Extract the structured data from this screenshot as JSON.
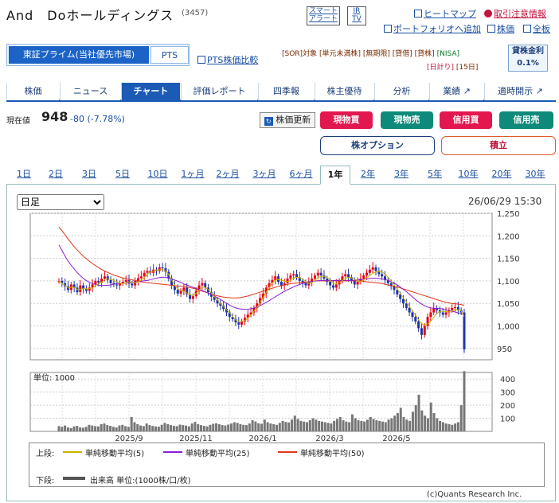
{
  "header": {
    "title": "And　Doホールディングス",
    "code": "(3457)",
    "smart_alert": [
      "スマート",
      "アラート"
    ],
    "ir_tv": [
      "IR",
      "TV"
    ],
    "links": {
      "heatmap": "ヒートマップ",
      "caution": "取引注意情報",
      "portfolio": "ポートフォリオへ追加",
      "stock": "株価",
      "board": "全板"
    }
  },
  "market": {
    "selected": "東証プライム(当社優先市場)",
    "pts": "PTS",
    "pts_compare": "PTS株価比較"
  },
  "tags": [
    "[SOR]対象",
    "[単元未満株]",
    "[無期限]",
    "[貸借]",
    "[貸株]",
    "[NISA]",
    "[日計り]",
    "[15日]"
  ],
  "lending": {
    "label": "貸株金利",
    "value": "0.1%"
  },
  "nav": {
    "tabs": [
      "株価",
      "ニュース",
      "チャート",
      "評価レポート",
      "四季報",
      "株主優待",
      "分析",
      "業績",
      "適時開示"
    ],
    "active": "チャート"
  },
  "quote": {
    "label": "現在値",
    "price": "948",
    "change": "-80 (-7.78%)",
    "update_btn": "株価更新",
    "buy_cash": "現物買",
    "sell_cash": "現物売",
    "buy_margin": "信用買",
    "sell_margin": "信用売",
    "stock_option": "株オプション",
    "accumulate": "積立"
  },
  "periods": [
    "1日",
    "2日",
    "3日",
    "5日",
    "10日",
    "1ヶ月",
    "2ヶ月",
    "3ヶ月",
    "6ヶ月",
    "1年",
    "2年",
    "3年",
    "5年",
    "10年",
    "20年",
    "30年"
  ],
  "active_period": "1年",
  "chart_controls": {
    "interval": "日足",
    "timestamp": "26/06/29 15:30"
  },
  "legend": {
    "upper_label": "上段:",
    "ma5": "単純移動平均(5)",
    "ma25": "単純移動平均(25)",
    "ma50": "単純移動平均(50)",
    "lower_label": "下段:",
    "volume": "出来高 単位:(1000株/口/枚)"
  },
  "copyright": "(c)Quants Research Inc.",
  "chart_data": [
    {
      "type": "candlestick",
      "ylim": [
        925,
        1250
      ],
      "yticks": [
        "1,250",
        "1,200",
        "1,150",
        "1,100",
        "1,050",
        "1,000",
        "950"
      ],
      "xticks": [
        "2025/9",
        "2025/11",
        "2026/1",
        "2026/3",
        "2026/5"
      ],
      "colors": {
        "up": "#e60012",
        "down": "#1f35a8",
        "ma5": "#c9b400",
        "ma25": "#8a1ed6",
        "ma50": "#e0341a"
      },
      "close_series": [
        1100,
        1095,
        1088,
        1080,
        1092,
        1085,
        1075,
        1090,
        1082,
        1078,
        1085,
        1092,
        1100,
        1096,
        1105,
        1110,
        1102,
        1095,
        1092,
        1090,
        1095,
        1098,
        1102,
        1094,
        1090,
        1100,
        1106,
        1110,
        1118,
        1122,
        1118,
        1125,
        1122,
        1130,
        1128,
        1120,
        1105,
        1090,
        1080,
        1072,
        1078,
        1085,
        1070,
        1060,
        1066,
        1078,
        1090,
        1095,
        1085,
        1075,
        1065,
        1058,
        1050,
        1045,
        1038,
        1030,
        1020,
        1015,
        1008,
        1003,
        1010,
        1018,
        1025,
        1030,
        1040,
        1050,
        1062,
        1072,
        1085,
        1095,
        1102,
        1110,
        1098,
        1090,
        1095,
        1105,
        1112,
        1115,
        1108,
        1100,
        1095,
        1090,
        1098,
        1105,
        1112,
        1118,
        1112,
        1105,
        1098,
        1090,
        1085,
        1092,
        1100,
        1110,
        1115,
        1108,
        1100,
        1092,
        1098,
        1105,
        1112,
        1118,
        1125,
        1130,
        1122,
        1115,
        1110,
        1102,
        1095,
        1088,
        1080,
        1070,
        1060,
        1050,
        1040,
        1030,
        1020,
        1010,
        995,
        980,
        1000,
        1020,
        1030,
        1040,
        1035,
        1030,
        1025,
        1030,
        1035,
        1040,
        1042,
        1035,
        1030,
        948
      ],
      "ma5": [
        1100,
        1094,
        1090,
        1084,
        1086,
        1085,
        1080,
        1082,
        1083,
        1082,
        1083,
        1086,
        1092,
        1095,
        1100,
        1105,
        1104,
        1102,
        1099,
        1095,
        1094,
        1095,
        1098,
        1097,
        1096,
        1098,
        1102,
        1108,
        1115,
        1120,
        1122,
        1124,
        1125,
        1125,
        1121,
        1110,
        1097,
        1086,
        1080,
        1078,
        1075,
        1070,
        1068,
        1070,
        1077,
        1085,
        1086,
        1082,
        1074,
        1066,
        1058,
        1050,
        1043,
        1036,
        1028,
        1020,
        1012,
        1010,
        1010,
        1013,
        1020,
        1027,
        1036,
        1046,
        1058,
        1069,
        1081,
        1092,
        1100,
        1103,
        1102,
        1100,
        1098,
        1100,
        1106,
        1108,
        1107,
        1104,
        1098,
        1094,
        1096,
        1102,
        1108,
        1110,
        1110,
        1106,
        1099,
        1093,
        1094,
        1098,
        1104,
        1107,
        1108,
        1105,
        1102,
        1098,
        1101,
        1106,
        1111,
        1116,
        1120,
        1121,
        1120,
        1115,
        1108,
        1099,
        1090,
        1080,
        1070,
        1060,
        1050,
        1040,
        1030,
        1020,
        1009,
        1003,
        1003,
        1007,
        1015,
        1025,
        1031,
        1033,
        1032,
        1031,
        1033,
        1036,
        1036,
        1034,
        1020
      ],
      "ma25": [
        1180,
        1165,
        1150,
        1138,
        1128,
        1118,
        1110,
        1103,
        1098,
        1094,
        1092,
        1090,
        1090,
        1090,
        1091,
        1093,
        1094,
        1095,
        1095,
        1096,
        1097,
        1098,
        1099,
        1100,
        1101,
        1103,
        1105,
        1107,
        1108,
        1108,
        1106,
        1103,
        1100,
        1097,
        1093,
        1090,
        1087,
        1084,
        1081,
        1078,
        1075,
        1071,
        1067,
        1063,
        1058,
        1053,
        1048,
        1043,
        1040,
        1038,
        1037,
        1037,
        1038,
        1040,
        1043,
        1047,
        1051,
        1056,
        1061,
        1066,
        1071,
        1076,
        1080,
        1084,
        1088,
        1091,
        1094,
        1096,
        1098,
        1099,
        1100,
        1101,
        1101,
        1101,
        1101,
        1101,
        1101,
        1101,
        1101,
        1101,
        1101,
        1102,
        1103,
        1104,
        1105,
        1106,
        1106,
        1105,
        1104,
        1102,
        1099,
        1095,
        1090,
        1084,
        1078,
        1071,
        1064,
        1057,
        1051,
        1046,
        1042,
        1040,
        1039,
        1039,
        1038,
        1036,
        1034,
        1032,
        1030,
        1028,
        1026
      ],
      "ma50": [
        1220,
        1208,
        1195,
        1183,
        1172,
        1162,
        1153,
        1145,
        1138,
        1132,
        1126,
        1121,
        1117,
        1113,
        1110,
        1107,
        1105,
        1103,
        1101,
        1099,
        1097,
        1096,
        1095,
        1094,
        1093,
        1092,
        1091,
        1090,
        1089,
        1088,
        1087,
        1085,
        1083,
        1080,
        1077,
        1074,
        1071,
        1068,
        1066,
        1064,
        1063,
        1062,
        1062,
        1063,
        1065,
        1067,
        1070,
        1073,
        1076,
        1079,
        1082,
        1085,
        1088,
        1090,
        1092,
        1094,
        1095,
        1096,
        1097,
        1098,
        1099,
        1100,
        1100,
        1100,
        1100,
        1100,
        1100,
        1100,
        1100,
        1100,
        1100,
        1100,
        1099,
        1098,
        1097,
        1096,
        1095,
        1093,
        1091,
        1089,
        1087,
        1084,
        1081,
        1078,
        1075,
        1072,
        1069,
        1066,
        1063,
        1060,
        1057,
        1054,
        1052,
        1050,
        1049,
        1048,
        1046
      ]
    },
    {
      "type": "bar",
      "name": "出来高",
      "ylim": [
        0,
        450
      ],
      "yticks": [
        "400",
        "300",
        "200",
        "100"
      ],
      "unit_label": "単位: 1000",
      "values": [
        40,
        35,
        45,
        30,
        25,
        38,
        42,
        30,
        28,
        35,
        50,
        45,
        40,
        38,
        55,
        60,
        48,
        42,
        35,
        30,
        45,
        50,
        40,
        35,
        110,
        70,
        55,
        45,
        40,
        60,
        48,
        42,
        38,
        36,
        50,
        65,
        55,
        48,
        42,
        40,
        52,
        48,
        44,
        38,
        60,
        72,
        55,
        48,
        42,
        38,
        50,
        58,
        62,
        55,
        48,
        45,
        52,
        60,
        70,
        65,
        55,
        50,
        48,
        60,
        85,
        75,
        62,
        58,
        90,
        70,
        60,
        55,
        50,
        65,
        80,
        72,
        68,
        90,
        120,
        95,
        80,
        75,
        70,
        85,
        100,
        90,
        80,
        75,
        70,
        65,
        60,
        80,
        95,
        110,
        85,
        75,
        70,
        130,
        100,
        85,
        80,
        75,
        90,
        110,
        95,
        85,
        80,
        75,
        70,
        90,
        100,
        120,
        140,
        180,
        110,
        90,
        80,
        150,
        200,
        280,
        160,
        120,
        100,
        220,
        140,
        100,
        80,
        70,
        60,
        55,
        50,
        60,
        70,
        200,
        460
      ]
    }
  ]
}
